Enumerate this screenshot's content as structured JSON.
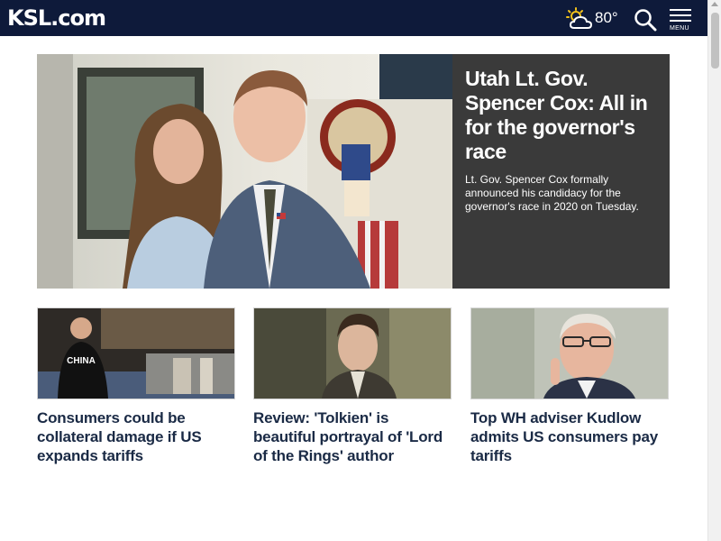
{
  "header": {
    "logo": "KSL.com",
    "weather": {
      "icon": "partly-cloudy-sun-icon",
      "temperature": "80°"
    },
    "search_icon": "search-icon",
    "menu_label": "MENU",
    "background_color": "#0e1a3a"
  },
  "hero": {
    "title": "Utah Lt. Gov. Spencer Cox: All in for the governor's race",
    "summary": "Lt. Gov. Spencer Cox formally announced his candidacy for the governor's race in 2020 on Tuesday.",
    "panel_color": "#3a3a3a"
  },
  "cards": [
    {
      "title": "Consumers could be collateral damage if US expands tariffs",
      "shirt_text": "CHINA"
    },
    {
      "title": "Review: 'Tolkien' is beautiful portrayal of 'Lord of the Rings' author"
    },
    {
      "title": "Top WH adviser Kudlow admits US consumers pay tariffs"
    }
  ],
  "colors": {
    "headline_text": "#1a2a45",
    "accent": "#0e1a3a"
  }
}
